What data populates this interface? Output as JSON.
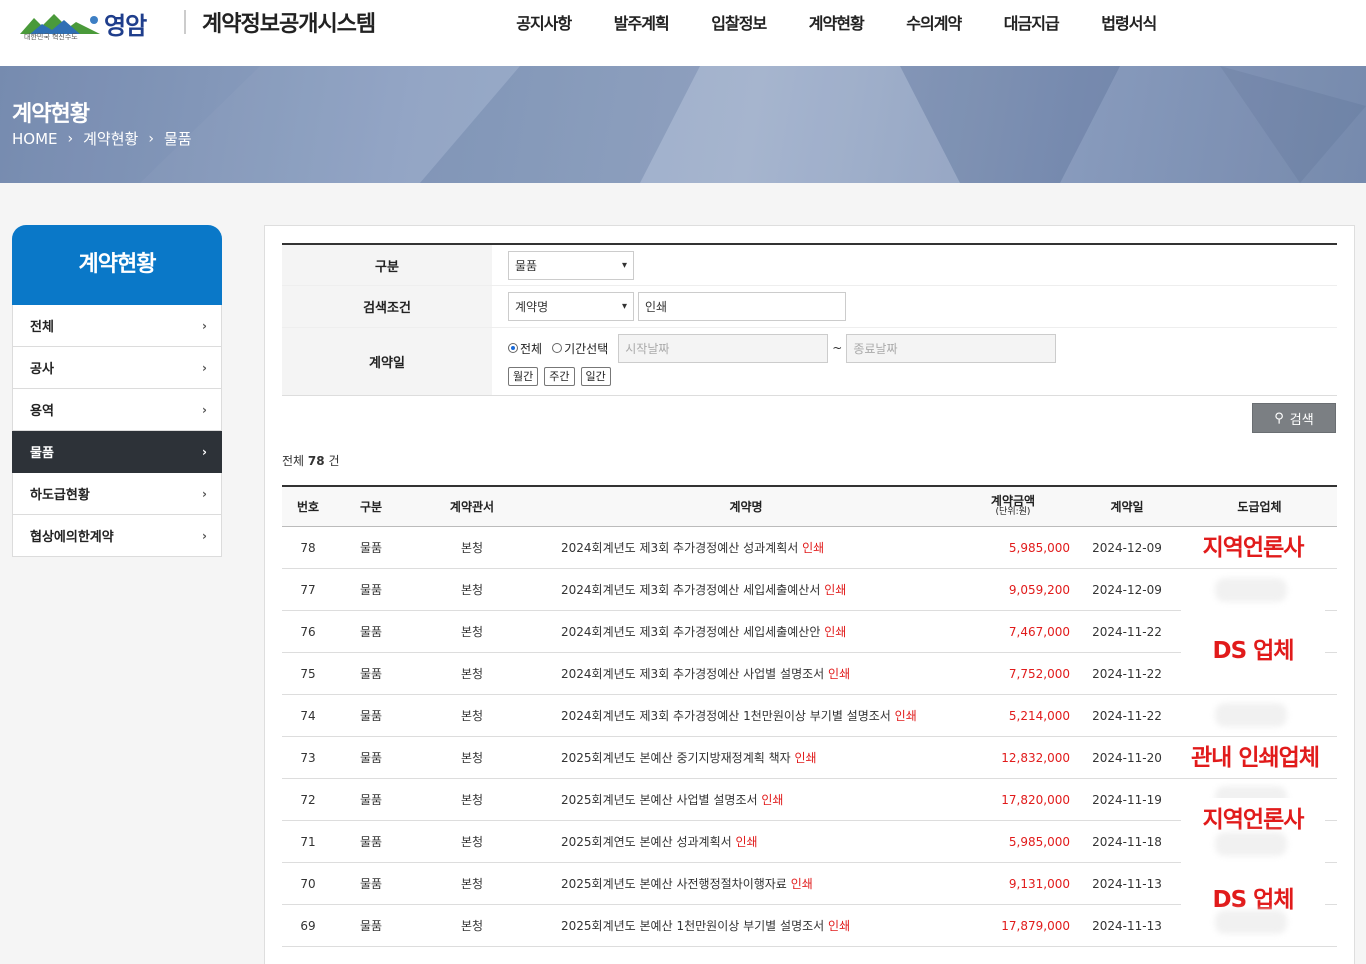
{
  "header": {
    "logo_name": "영암",
    "logo_sub": "대한민국 혁신수도",
    "system_title": "계약정보공개시스템",
    "nav": [
      "공지사항",
      "발주계획",
      "입찰정보",
      "계약현황",
      "수의계약",
      "대금지급",
      "법령서식"
    ]
  },
  "banner": {
    "title": "계약현황",
    "breadcrumb": [
      "HOME",
      "계약현황",
      "물품"
    ]
  },
  "sidebar": {
    "title": "계약현황",
    "items": [
      {
        "label": "전체"
      },
      {
        "label": "공사"
      },
      {
        "label": "용역"
      },
      {
        "label": "물품"
      },
      {
        "label": "하도급현황"
      },
      {
        "label": "협상에의한계약"
      }
    ],
    "active": "물품"
  },
  "search": {
    "type_label": "구분",
    "type_value": "물품",
    "cond_label": "검색조건",
    "cond_value": "계약명",
    "keyword": "인쇄",
    "date_label": "계약일",
    "radio_all": "전체",
    "radio_period": "기간선택",
    "start_placeholder": "시작날짜",
    "end_placeholder": "종료날짜",
    "tilde": "~",
    "btn_month": "월간",
    "btn_week": "주간",
    "btn_day": "일간",
    "search_button": "검색"
  },
  "summary": {
    "prefix": "전체",
    "count": "78",
    "suffix": "건"
  },
  "table": {
    "headers": {
      "no": "번호",
      "type": "구분",
      "office": "계약관서",
      "name": "계약명",
      "amount": "계약금액",
      "amount_unit": "(단위:원)",
      "date": "계약일",
      "vendor": "도급업체"
    },
    "rows": [
      {
        "no": "78",
        "type": "물품",
        "office": "본청",
        "name": "2024회계년도 제3회 추가경정예산 성과계획서",
        "hl": "인쇄",
        "amount": "5,985,000",
        "date": "2024-12-09"
      },
      {
        "no": "77",
        "type": "물품",
        "office": "본청",
        "name": "2024회계년도 제3회 추가경정예산 세입세출예산서",
        "hl": "인쇄",
        "amount": "9,059,200",
        "date": "2024-12-09"
      },
      {
        "no": "76",
        "type": "물품",
        "office": "본청",
        "name": "2024회계년도 제3회 추가경정예산 세입세출예산안",
        "hl": "인쇄",
        "amount": "7,467,000",
        "date": "2024-11-22"
      },
      {
        "no": "75",
        "type": "물품",
        "office": "본청",
        "name": "2024회계년도 제3회 추가경정예산 사업별 설명조서",
        "hl": "인쇄",
        "amount": "7,752,000",
        "date": "2024-11-22"
      },
      {
        "no": "74",
        "type": "물품",
        "office": "본청",
        "name": "2024회계년도 제3회 추가경정예산 1천만원이상 부기별 설명조서",
        "hl": "인쇄",
        "amount": "5,214,000",
        "date": "2024-11-22"
      },
      {
        "no": "73",
        "type": "물품",
        "office": "본청",
        "name": "2025회계년도 본예산 중기지방재정계획 책자",
        "hl": "인쇄",
        "amount": "12,832,000",
        "date": "2024-11-20"
      },
      {
        "no": "72",
        "type": "물품",
        "office": "본청",
        "name": "2025회계년도 본예산 사업별 설명조서",
        "hl": "인쇄",
        "amount": "17,820,000",
        "date": "2024-11-19"
      },
      {
        "no": "71",
        "type": "물품",
        "office": "본청",
        "name": "2025회계연도 본예산 성과계획서",
        "hl": "인쇄",
        "amount": "5,985,000",
        "date": "2024-11-18"
      },
      {
        "no": "70",
        "type": "물품",
        "office": "본청",
        "name": "2025회계년도 본예산 사전행정절차이행자료",
        "hl": "인쇄",
        "amount": "9,131,000",
        "date": "2024-11-13"
      },
      {
        "no": "69",
        "type": "물품",
        "office": "본청",
        "name": "2025회계년도 본예산 1천만원이상 부기별 설명조서",
        "hl": "인쇄",
        "amount": "17,879,000",
        "date": "2024-11-13"
      }
    ]
  },
  "annotations": [
    "지역언론사",
    "DS 업체",
    "관내 인쇄업체",
    "지역언론사",
    "DS 업체"
  ],
  "colors": {
    "accent_blue": "#0a78c8",
    "highlight_red": "#e11b1b",
    "sidebar_active": "#2d3238"
  }
}
